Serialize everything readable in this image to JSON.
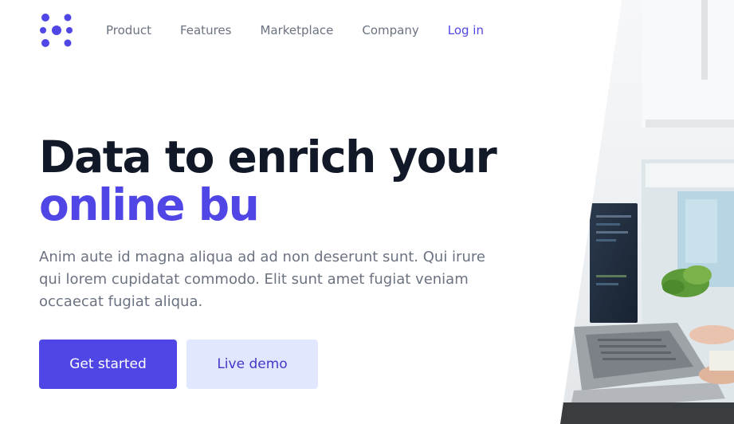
{
  "brand": {
    "logo_icon": "dots-logo-icon",
    "color": "#4f46e5"
  },
  "nav": {
    "items": [
      {
        "label": "Product"
      },
      {
        "label": "Features"
      },
      {
        "label": "Marketplace"
      },
      {
        "label": "Company"
      }
    ],
    "login_label": "Log in"
  },
  "hero": {
    "title_line1": "Data to enrich your",
    "title_line2": "online bu",
    "description": "Anim aute id magna aliqua ad ad non deserunt sunt. Qui irure qui lorem cupidatat commodo. Elit sunt amet fugiat veniam occaecat fugiat aliqua.",
    "primary_cta": "Get started",
    "secondary_cta": "Live demo"
  },
  "colors": {
    "accent": "#4f46e5",
    "accent_light": "#e0e7ff",
    "text_dark": "#111827",
    "text_muted": "#6b7280"
  },
  "image": {
    "subject": "office-laptop-photo"
  }
}
